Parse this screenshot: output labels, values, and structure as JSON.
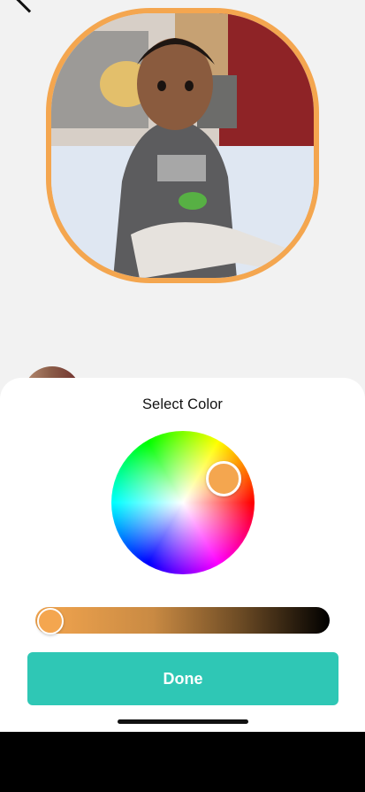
{
  "header": {
    "back_icon": "chevron-left-icon"
  },
  "profile": {
    "border_color": "#f4a64f"
  },
  "color_picker": {
    "title": "Select Color",
    "selected_color": "#f4a64f",
    "done_label": "Done",
    "done_color": "#2fc7b5"
  }
}
